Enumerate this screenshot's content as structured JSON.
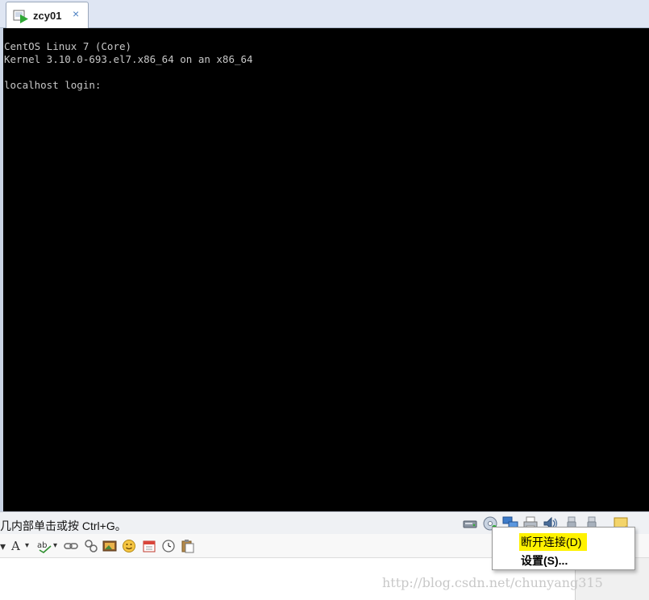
{
  "tab": {
    "title": "zcy01",
    "close": "×"
  },
  "console": {
    "lines": [
      "CentOS Linux 7 (Core)",
      "Kernel 3.10.0-693.el7.x86_64 on an x86_64",
      "",
      "localhost login:"
    ]
  },
  "statusbar": {
    "hint": "几内部单击或按 Ctrl+G。",
    "icons": [
      "hard-disk-icon",
      "cd-dvd-icon",
      "network-adapter-icon",
      "printer-icon",
      "sound-card-icon",
      "usb-device-icon",
      "usb-device-icon",
      "message-icon"
    ]
  },
  "context_menu": {
    "items": [
      {
        "label": "断开连接(D)",
        "highlighted": true
      },
      {
        "label": "设置(S)..."
      }
    ]
  },
  "toolbar": {
    "font_color_label": "A",
    "items": [
      "font-color-icon",
      "spellcheck-icon",
      "link-icon",
      "unlink-icon",
      "image-icon",
      "emoticon-icon",
      "calendar-icon",
      "clock-icon",
      "paste-icon"
    ]
  },
  "watermark": "http://blog.csdn.net/chunyang315",
  "colors": {
    "highlight": "#fff200",
    "console_bg": "#000000",
    "console_fg": "#c8c8c8"
  }
}
